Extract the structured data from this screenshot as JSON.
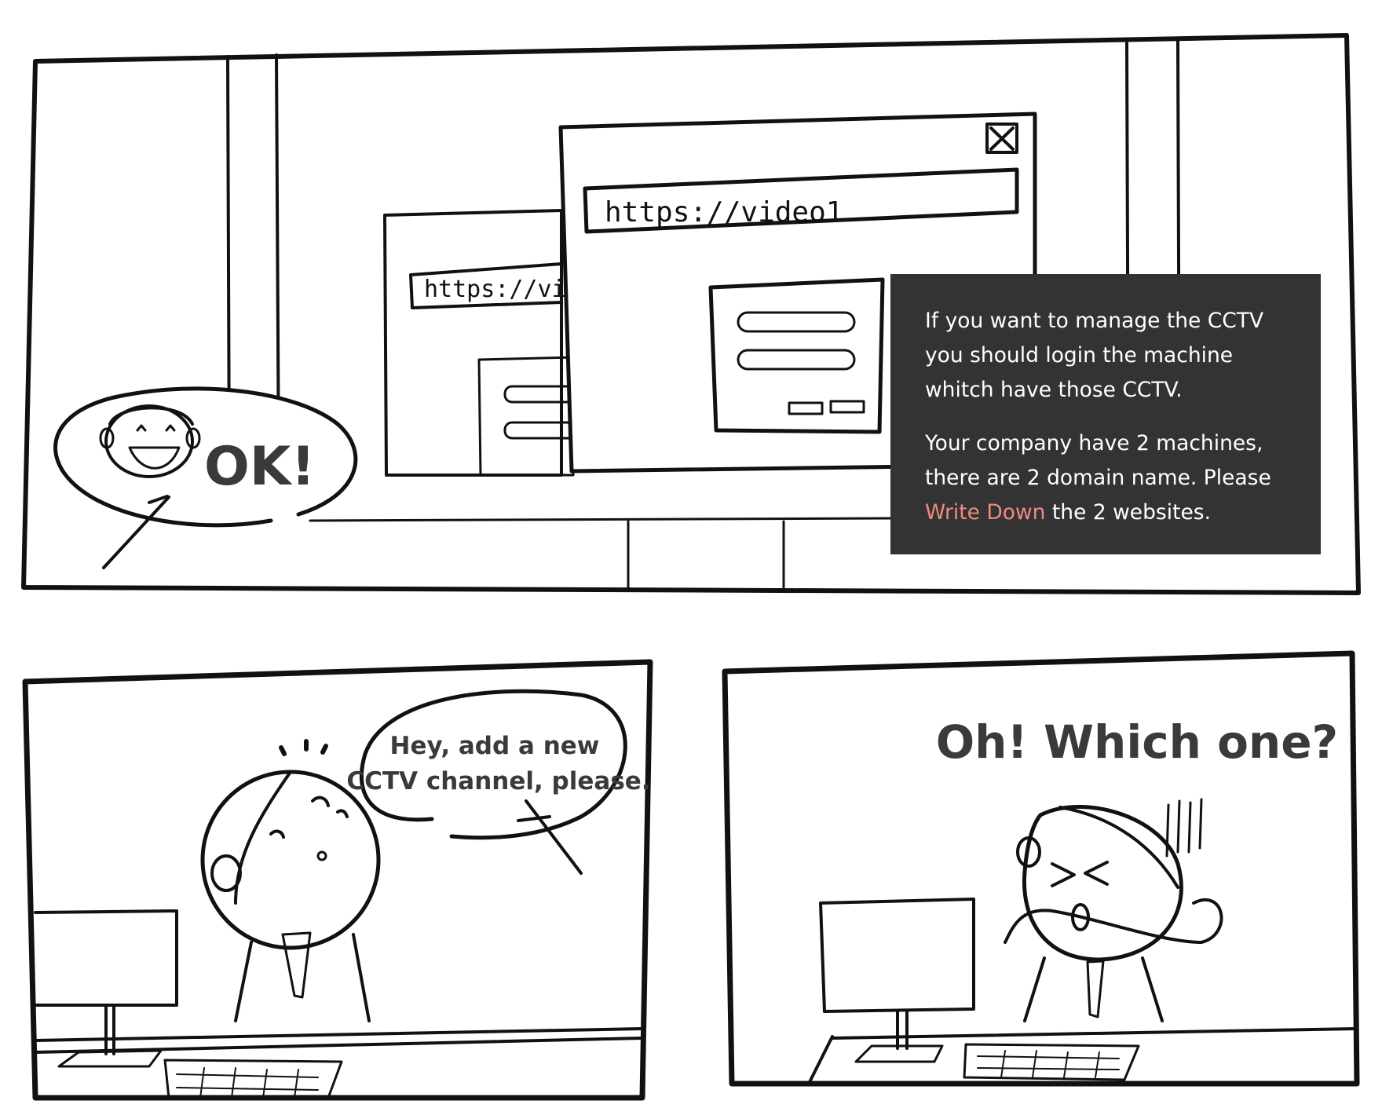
{
  "panel1": {
    "url_front": "https://video1",
    "url_back": "https://vic",
    "shout": "OK!",
    "info": {
      "para1": "If you want to manage the CCTV you should login the machine whitch have those CCTV.",
      "para2_before": "Your company have 2 machines, there are 2 domain name. Please ",
      "para2_highlight": "Write Down",
      "para2_after": " the 2 websites.",
      "highlight_color": "#f08a80",
      "background_color": "#333333"
    }
  },
  "panel2": {
    "speech_line1": "Hey, add a new",
    "speech_line2": "CCTV channel, please."
  },
  "panel3": {
    "exclaim": "Oh! Which one?"
  },
  "icons": [
    "close-icon",
    "smiling-face-icon"
  ]
}
